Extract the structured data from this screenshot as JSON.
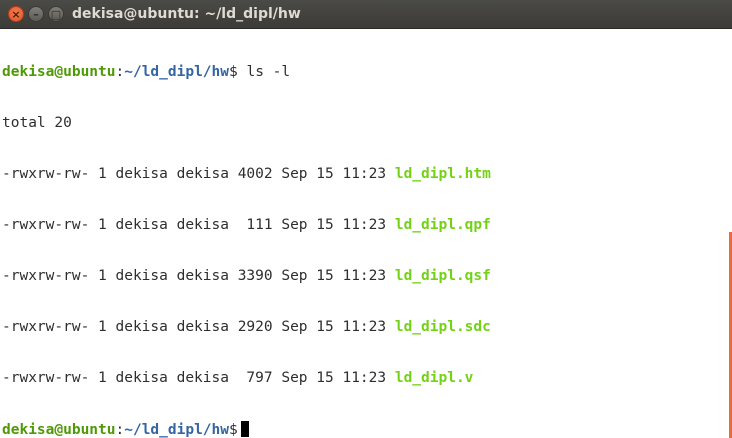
{
  "window": {
    "title": "dekisa@ubuntu: ~/ld_dipl/hw",
    "buttons": {
      "close": "×",
      "minimize": "–",
      "maximize": "□"
    }
  },
  "prompt": {
    "user_host": "dekisa@ubuntu",
    "separator": ":",
    "path": "~/ld_dipl/hw",
    "symbol": "$"
  },
  "command": " ls -l",
  "total_line": "total 20",
  "listing": [
    {
      "meta": "-rwxrw-rw- 1 dekisa dekisa 4002 Sep 15 11:23 ",
      "name": "ld_dipl.htm"
    },
    {
      "meta": "-rwxrw-rw- 1 dekisa dekisa  111 Sep 15 11:23 ",
      "name": "ld_dipl.qpf"
    },
    {
      "meta": "-rwxrw-rw- 1 dekisa dekisa 3390 Sep 15 11:23 ",
      "name": "ld_dipl.qsf"
    },
    {
      "meta": "-rwxrw-rw- 1 dekisa dekisa 2920 Sep 15 11:23 ",
      "name": "ld_dipl.sdc"
    },
    {
      "meta": "-rwxrw-rw- 1 dekisa dekisa  797 Sep 15 11:23 ",
      "name": "ld_dipl.v"
    }
  ],
  "colors": {
    "prompt_user": "#4e9a06",
    "prompt_path": "#3465a4",
    "executable_file": "#73d216",
    "close_button": "#e0582a"
  }
}
